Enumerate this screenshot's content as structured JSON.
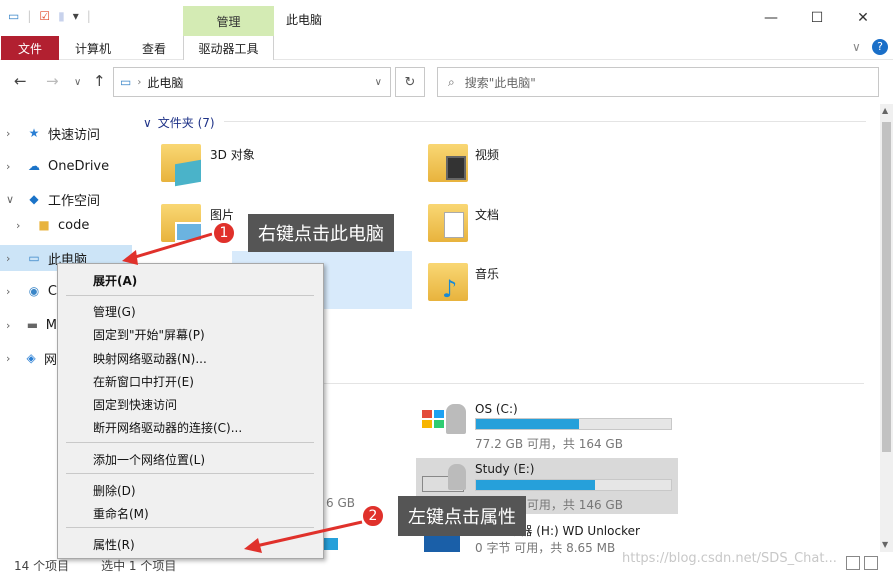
{
  "window": {
    "title": "此电脑",
    "manage_label": "管理"
  },
  "ribbon": {
    "file": "文件",
    "computer": "计算机",
    "view": "查看",
    "drive_tools": "驱动器工具"
  },
  "address": {
    "path": "此电脑",
    "search_placeholder": "搜索\"此电脑\""
  },
  "nav": {
    "quick_access": "快速访问",
    "onedrive": "OneDrive",
    "workspace": "工作空间",
    "code": "code",
    "this_pc": "此电脑",
    "c_partial": "C",
    "m_partial": "M",
    "net_partial": "网"
  },
  "folders": {
    "header": "文件夹 (7)",
    "items": [
      "3D 对象",
      "视频",
      "图片",
      "文档",
      "音乐"
    ]
  },
  "drives": {
    "os": {
      "name": "OS (C:)",
      "info": "77.2 GB 可用，共 164 GB",
      "used": 0.53
    },
    "study": {
      "name": "Study (E:)",
      "info": "56.2 GB 可用，共 146 GB",
      "used": 0.61
    },
    "cd": {
      "name": "CD 驱动器 (H:) WD Unlocker",
      "info": "0 字节 可用，共 8.65 MB",
      "used": 1.0
    },
    "left_partial": "6 GB"
  },
  "context_menu": {
    "expand": "展开(A)",
    "manage": "管理(G)",
    "pin_start": "固定到\"开始\"屏幕(P)",
    "map_drive": "映射网络驱动器(N)...",
    "open_new": "在新窗口中打开(E)",
    "pin_quick": "固定到快速访问",
    "disconnect": "断开网络驱动器的连接(C)...",
    "add_location": "添加一个网络位置(L)",
    "delete": "删除(D)",
    "rename": "重命名(M)",
    "properties": "属性(R)"
  },
  "annotations": {
    "step1_num": "1",
    "step1_text": "右键点击此电脑",
    "step2_num": "2",
    "step2_text": "左键点击属性"
  },
  "status": {
    "count": "14 个项目",
    "selected": "选中 1 个项目"
  },
  "watermark": "https://blog.csdn.net/SDS_Chat...",
  "colors": {
    "accent": "#26a0da",
    "file_tab": "#b22030",
    "manage_tab": "#d4ebb4",
    "annotation_red": "#e0312b"
  }
}
